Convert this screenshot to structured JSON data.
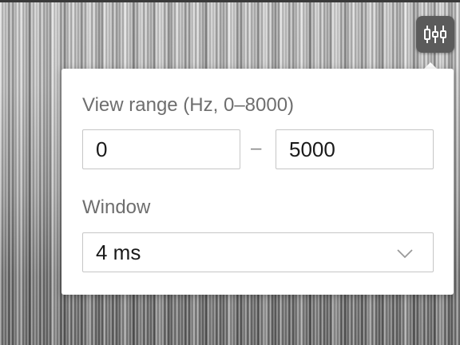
{
  "settings_button": {
    "icon": "sliders-icon"
  },
  "popover": {
    "range_label": "View range (Hz, 0–8000)",
    "range_min_value": "0",
    "range_separator": "–",
    "range_max_value": "5000",
    "window_label": "Window",
    "window_selected": "4 ms"
  },
  "colors": {
    "button_bg": "#5b5b5b",
    "label": "#6e6e6e",
    "border": "#c6c6c6"
  }
}
